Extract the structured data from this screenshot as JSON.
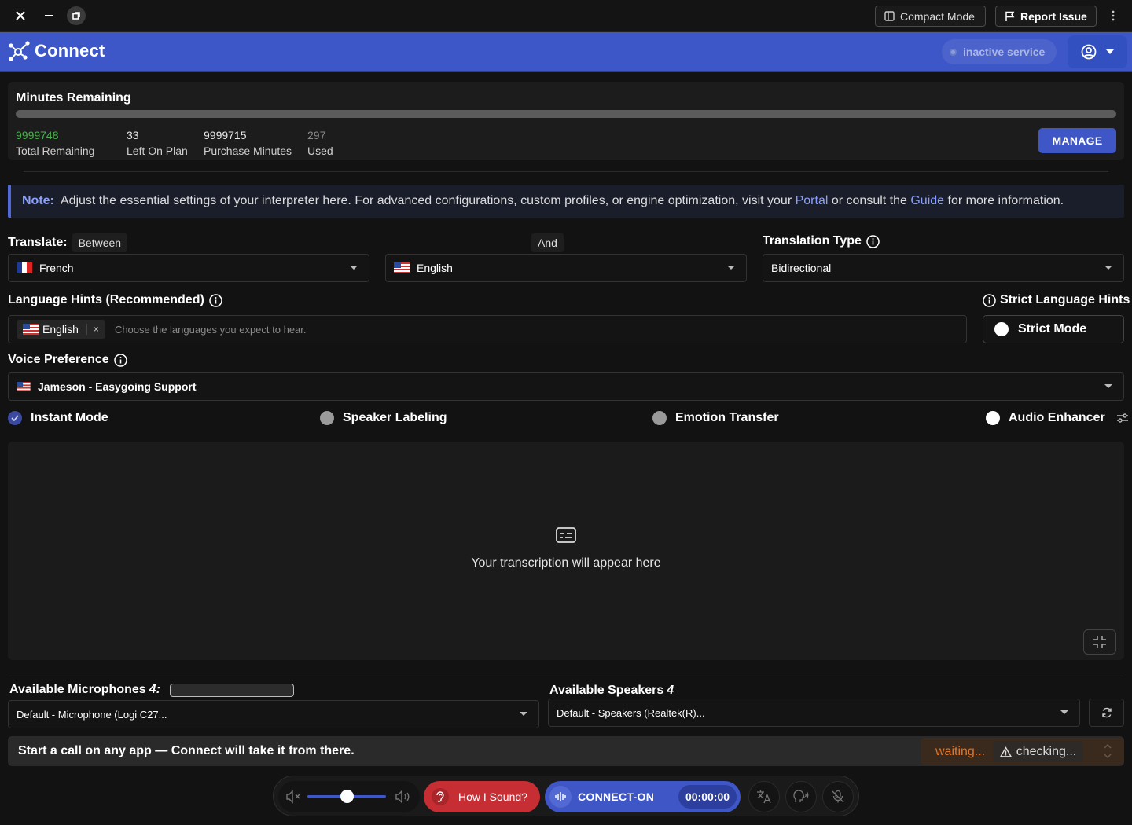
{
  "titlebar": {
    "compact_mode": "Compact Mode",
    "report_issue": "Report Issue"
  },
  "header": {
    "app_name": "Connect",
    "service_status": "inactive service"
  },
  "minutes": {
    "title": "Minutes Remaining",
    "used_fraction": 0.0,
    "stats": [
      {
        "value": "9999748",
        "label": "Total Remaining",
        "color": "#4caf50"
      },
      {
        "value": "33",
        "label": "Left On Plan"
      },
      {
        "value": "9999715",
        "label": "Purchase Minutes"
      },
      {
        "value": "297",
        "label": "Used"
      }
    ],
    "manage": "MANAGE"
  },
  "note": {
    "prefix": "Note:",
    "text1": "Adjust the essential settings of your interpreter here. For advanced configurations, custom profiles, or engine optimization, visit your",
    "portal": "Portal",
    "text2": "or consult the",
    "guide": "Guide",
    "text3": "for more information."
  },
  "translate": {
    "label": "Translate:",
    "between": "Between",
    "and": "And",
    "lang_a": "French",
    "lang_b": "English",
    "type_label": "Translation Type",
    "type_value": "Bidirectional"
  },
  "hints": {
    "label": "Language Hints (Recommended)",
    "chip": "English",
    "chip_remove": "×",
    "placeholder": "Choose the languages you expect to hear.",
    "strict_label": "Strict Language Hints",
    "strict_mode": "Strict Mode"
  },
  "voice": {
    "label": "Voice Preference",
    "value": "Jameson - Easygoing Support"
  },
  "toggles": {
    "instant": "Instant Mode",
    "speaker": "Speaker Labeling",
    "emotion": "Emotion Transfer",
    "enhancer": "Audio Enhancer"
  },
  "transcription": {
    "empty": "Your transcription will appear here"
  },
  "devices": {
    "mic_label": "Available Microphones",
    "mic_count": "4:",
    "mic_value": "Default - Microphone (Logi C27...",
    "spk_label": "Available Speakers",
    "spk_count": "4",
    "spk_value": "Default - Speakers (Realtek(R)..."
  },
  "statusbar": {
    "message": "Start a call on any app — Connect will take it from there.",
    "waiting": "waiting...",
    "checking": "checking..."
  },
  "controls": {
    "volume": 0.5,
    "how_sound": "How I Sound?",
    "connect": "CONNECT-ON",
    "timer": "00:00:00"
  },
  "colors": {
    "accent": "#3e56c6",
    "danger": "#c62e33",
    "warning": "#e0772b",
    "link": "#8aa0ff"
  }
}
